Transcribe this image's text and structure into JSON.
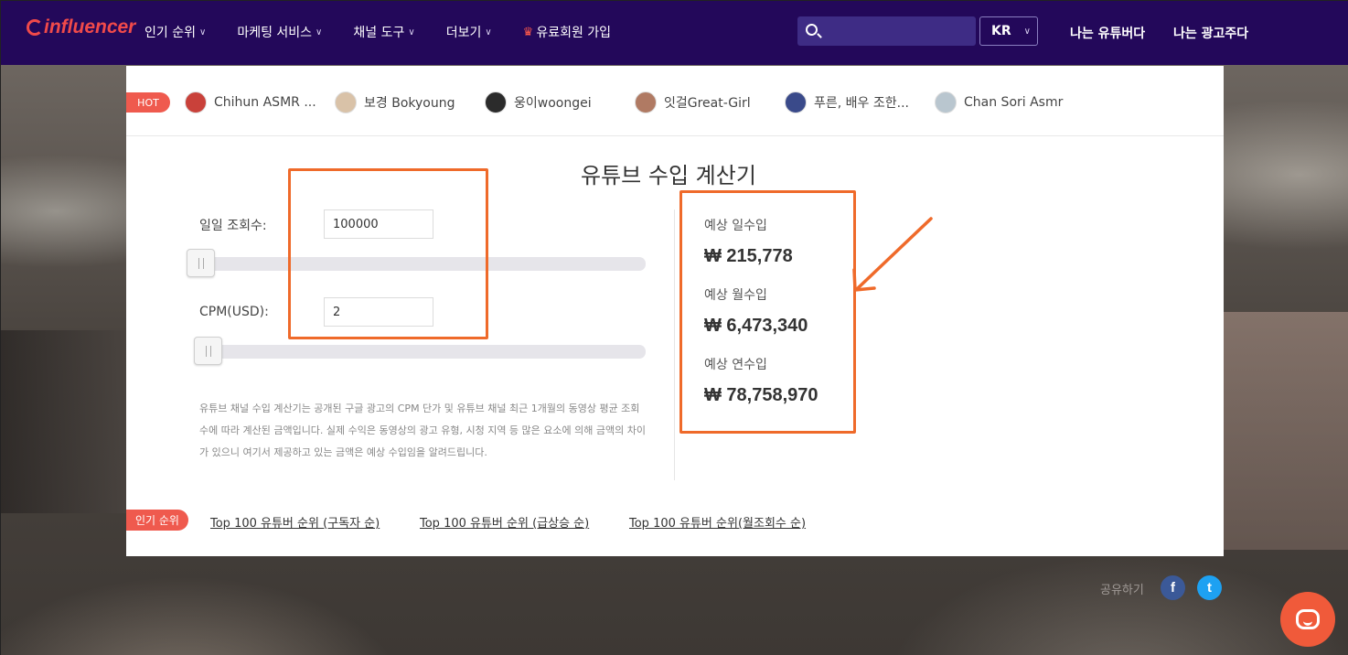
{
  "header": {
    "logo_text": "influencer",
    "nav": [
      {
        "label": "인기 순위",
        "has_dropdown": true
      },
      {
        "label": "마케팅 서비스",
        "has_dropdown": true
      },
      {
        "label": "채널 도구",
        "has_dropdown": true
      },
      {
        "label": "더보기",
        "has_dropdown": true
      },
      {
        "label": "유료회원 가입",
        "icon": "crown-icon"
      }
    ],
    "search": {
      "value": "",
      "placeholder": ""
    },
    "lang": "KR",
    "link_youtuber": "나는 유튜버다",
    "link_advertiser": "나는 광고주다"
  },
  "hot": {
    "badge": "HOT",
    "items": [
      {
        "name": "Chihun ASMR ...",
        "avatar_color": "#c9413a"
      },
      {
        "name": "보경 Bokyoung",
        "avatar_color": "#d9c2a8"
      },
      {
        "name": "웅이woongei",
        "avatar_color": "#2b2b2b"
      },
      {
        "name": "잇걸Great-Girl",
        "avatar_color": "#b07a63"
      },
      {
        "name": "푸른, 배우 조한...",
        "avatar_color": "#3a4a8a"
      },
      {
        "name": "Chan Sori Asmr",
        "avatar_color": "#b9c6cf"
      }
    ]
  },
  "calculator": {
    "title": "유튜브 수입 계산기",
    "daily_views_label": "일일 조회수:",
    "daily_views_value": "100000",
    "daily_views_slider_fraction": 0.0,
    "cpm_label": "CPM(USD):",
    "cpm_value": "2",
    "cpm_slider_fraction": 0.0,
    "description": "유튜브 채널 수입 계산기는 공개된 구글 광고의 CPM 단가 및 유튜브 채널 최근 1개월의 동영상 평균 조회수에 따라 계산된 금액입니다. 실제 수익은 동영상의 광고 유형, 시청 지역 등 많은 요소에 의해 금액의 차이가 있으니 여기서 제공하고 있는 금액은 예상 수입임을 알려드립니다.",
    "results": {
      "daily_label": "예상 일수입",
      "daily_value": "₩ 215,778",
      "monthly_label": "예상 월수입",
      "monthly_value": "₩ 6,473,340",
      "yearly_label": "예상 연수입",
      "yearly_value": "₩ 78,758,970"
    }
  },
  "ranking": {
    "badge": "인기 순위",
    "links": [
      "Top 100 유튜버 순위 (구독자 순)",
      "Top 100 유튜버 순위 (급상승 순)",
      "Top 100 유튜버 순위(월조회수 순)"
    ]
  },
  "share": {
    "label": "공유하기",
    "facebook": "f",
    "twitter": "t",
    "facebook_color": "#3b5998",
    "twitter_color": "#1da1f2"
  },
  "colors": {
    "header_bg": "#23085a",
    "accent": "#ef5a4e",
    "annotation": "#ef6a2a"
  }
}
